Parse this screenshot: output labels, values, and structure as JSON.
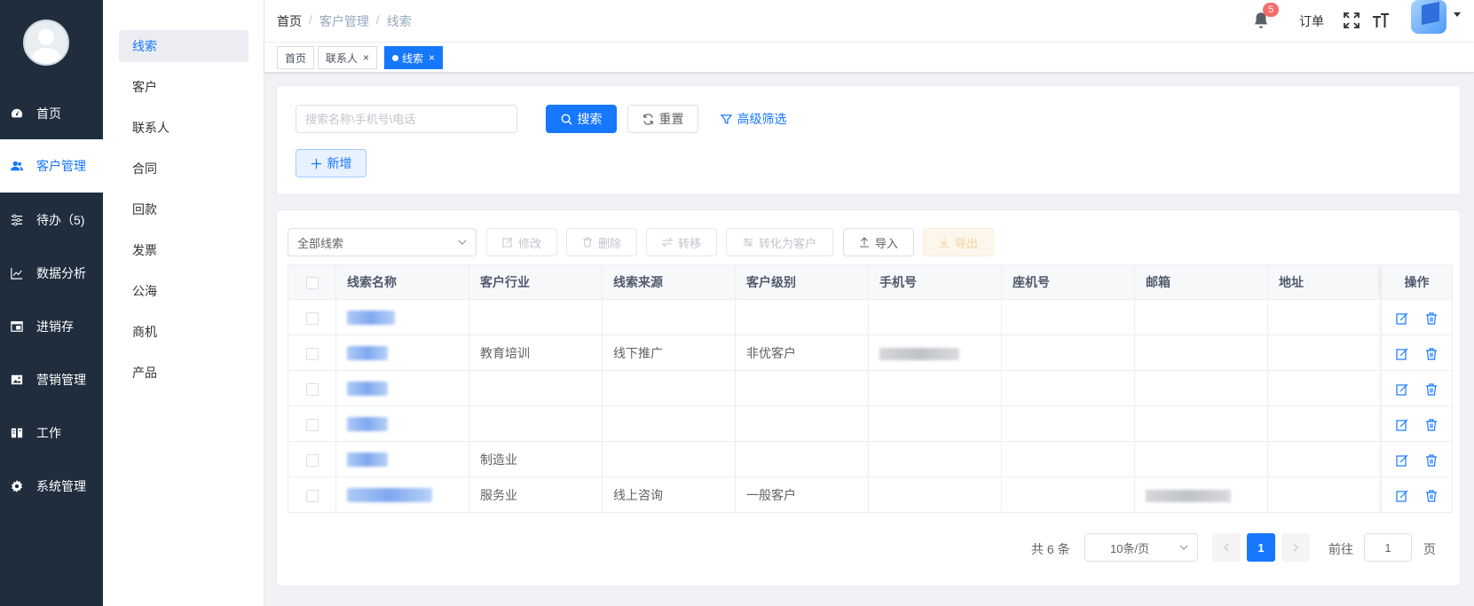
{
  "nav": {
    "items": [
      {
        "label": "首页",
        "icon": "dashboard-icon"
      },
      {
        "label": "客户管理",
        "icon": "users-icon",
        "active": true
      },
      {
        "label": "待办（5)",
        "icon": "sliders-icon"
      },
      {
        "label": "数据分析",
        "icon": "chart-icon"
      },
      {
        "label": "进销存",
        "icon": "window-icon"
      },
      {
        "label": "营销管理",
        "icon": "image-icon"
      },
      {
        "label": "工作",
        "icon": "book-icon"
      },
      {
        "label": "系统管理",
        "icon": "gear-icon"
      }
    ]
  },
  "submenu": {
    "items": [
      "线索",
      "客户",
      "联系人",
      "合同",
      "回款",
      "发票",
      "公海",
      "商机",
      "产品"
    ],
    "active_index": 0
  },
  "header": {
    "breadcrumb": [
      "首页",
      "客户管理",
      "线索"
    ],
    "separator": "/",
    "notification_count": "5",
    "order_label": "订单"
  },
  "tags": [
    {
      "label": "首页"
    },
    {
      "label": "联系人",
      "close": "×"
    },
    {
      "label": "线索",
      "close": "×",
      "active": true
    }
  ],
  "search": {
    "placeholder": "搜索名称\\手机号\\电话",
    "search_label": "搜索",
    "reset_label": "重置",
    "advanced_label": "高级筛选",
    "add_label": "新增"
  },
  "toolbar": {
    "filter_value": "全部线索",
    "edit_label": "修改",
    "delete_label": "删除",
    "transfer_label": "转移",
    "convert_label": "转化为客户",
    "import_label": "导入",
    "export_label": "导出"
  },
  "table": {
    "columns": [
      "线索名称",
      "客户行业",
      "线索来源",
      "客户级别",
      "手机号",
      "座机号",
      "邮箱",
      "地址",
      "操作"
    ],
    "rows": [
      {
        "industry": "",
        "source": "",
        "level": ""
      },
      {
        "industry": "教育培训",
        "source": "线下推广",
        "level": "非优客户"
      },
      {
        "industry": "",
        "source": "",
        "level": ""
      },
      {
        "industry": "",
        "source": "",
        "level": ""
      },
      {
        "industry": "制造业",
        "source": "",
        "level": ""
      },
      {
        "industry": "服务业",
        "source": "线上咨询",
        "level": "一般客户"
      }
    ]
  },
  "pagination": {
    "total_text": "共 6 条",
    "page_size": "10条/页",
    "current_page": "1",
    "goto_label": "前往",
    "goto_value": "1",
    "page_suffix": "页"
  },
  "colors": {
    "primary": "#1677ff",
    "nav_bg": "#1f2d3d",
    "badge": "#f56c6c"
  }
}
